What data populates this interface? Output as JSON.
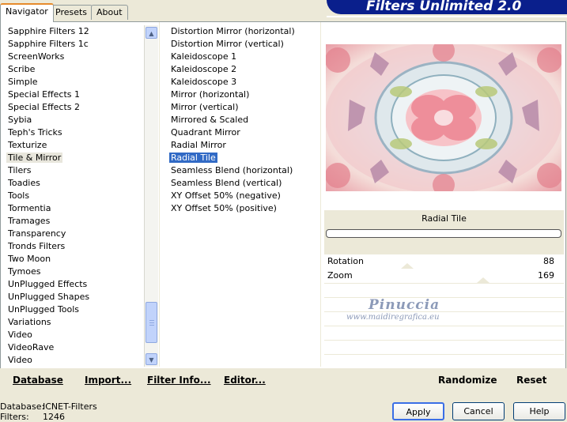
{
  "banner": {
    "title": "Filters Unlimited 2.0"
  },
  "tabs": [
    {
      "label": "Navigator",
      "active": true
    },
    {
      "label": "Presets",
      "active": false
    },
    {
      "label": "About",
      "active": false
    }
  ],
  "categories": [
    "Sapphire Filters 12",
    "Sapphire Filters 1c",
    "ScreenWorks",
    "Scribe",
    "Simple",
    "Special Effects 1",
    "Special Effects 2",
    "Sybia",
    "Teph's Tricks",
    "Texturize",
    "Tile & Mirror",
    "Tilers",
    "Toadies",
    "Tools",
    "Tormentia",
    "Tramages",
    "Transparency",
    "Tronds Filters",
    "Two Moon",
    "Tymoes",
    "UnPlugged Effects",
    "UnPlugged Shapes",
    "UnPlugged Tools",
    "Variations",
    "Video",
    "VideoRave",
    "Video"
  ],
  "selected_category": "Tile & Mirror",
  "filters": [
    "Distortion Mirror (horizontal)",
    "Distortion Mirror (vertical)",
    "Kaleidoscope 1",
    "Kaleidoscope 2",
    "Kaleidoscope 3",
    "Mirror (horizontal)",
    "Mirror (vertical)",
    "Mirrored & Scaled",
    "Quadrant Mirror",
    "Radial Mirror",
    "Radial Tile",
    "Seamless Blend (horizontal)",
    "Seamless Blend (vertical)",
    "XY Offset 50% (negative)",
    "XY Offset 50% (positive)"
  ],
  "selected_filter": "Radial Tile",
  "filter_panel": {
    "name": "Radial Tile",
    "params": [
      {
        "label": "Rotation",
        "value": "88",
        "level": 0.345
      },
      {
        "label": "Zoom",
        "value": "169",
        "level": 0.663
      }
    ]
  },
  "watermark": {
    "line1": "Pinuccia",
    "line2": "www.maidiregrafica.eu"
  },
  "bottom_buttons": {
    "database": "Database",
    "import": "Import...",
    "filter_info": "Filter Info...",
    "editor": "Editor...",
    "randomize": "Randomize",
    "reset": "Reset"
  },
  "status": {
    "database_label": "Database:",
    "database_value": "ICNET-Filters",
    "filters_label": "Filters:",
    "filters_value": "1246"
  },
  "actions": {
    "apply": "Apply",
    "cancel": "Cancel",
    "help": "Help"
  },
  "colors": {
    "selection": "#316ac5",
    "banner": "#0a1f8c",
    "tab_accent": "#e68b2c"
  }
}
